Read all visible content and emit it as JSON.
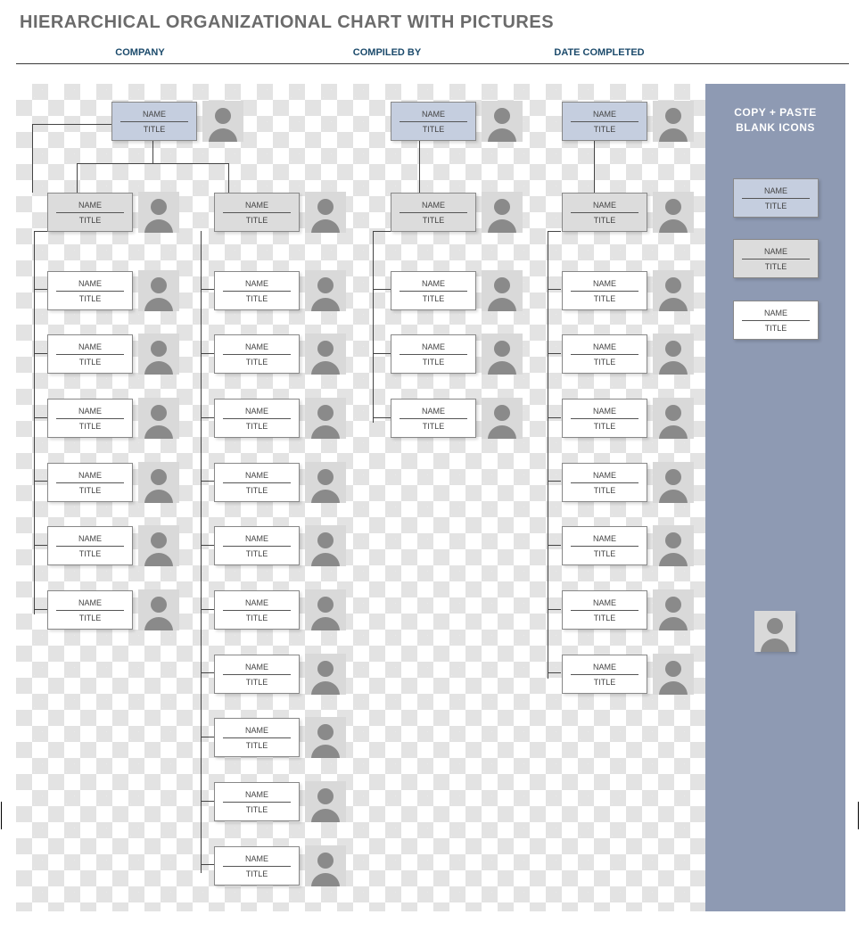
{
  "title": "HIERARCHICAL ORGANIZATIONAL CHART WITH PICTURES",
  "header": {
    "company": "COMPANY",
    "compiled_by": "COMPILED BY",
    "date_completed": "DATE COMPLETED"
  },
  "sidebar": {
    "title": "COPY + PASTE BLANK ICONS",
    "sample_top": {
      "name": "NAME",
      "title": "TITLE"
    },
    "sample_mid": {
      "name": "NAME",
      "title": "TITLE"
    },
    "sample_white": {
      "name": "NAME",
      "title": "TITLE"
    }
  },
  "people": {
    "col1_top": {
      "name": "NAME",
      "title": "TITLE"
    },
    "col1_m1": {
      "name": "NAME",
      "title": "TITLE"
    },
    "col1_m2": {
      "name": "NAME",
      "title": "TITLE"
    },
    "col1_1": {
      "name": "NAME",
      "title": "TITLE"
    },
    "col1_2": {
      "name": "NAME",
      "title": "TITLE"
    },
    "col1_3": {
      "name": "NAME",
      "title": "TITLE"
    },
    "col1_4": {
      "name": "NAME",
      "title": "TITLE"
    },
    "col1_5": {
      "name": "NAME",
      "title": "TITLE"
    },
    "col1_6": {
      "name": "NAME",
      "title": "TITLE"
    },
    "col2_1": {
      "name": "NAME",
      "title": "TITLE"
    },
    "col2_2": {
      "name": "NAME",
      "title": "TITLE"
    },
    "col2_3": {
      "name": "NAME",
      "title": "TITLE"
    },
    "col2_4": {
      "name": "NAME",
      "title": "TITLE"
    },
    "col2_5": {
      "name": "NAME",
      "title": "TITLE"
    },
    "col2_6": {
      "name": "NAME",
      "title": "TITLE"
    },
    "col2_7": {
      "name": "NAME",
      "title": "TITLE"
    },
    "col2_8": {
      "name": "NAME",
      "title": "TITLE"
    },
    "col2_9": {
      "name": "NAME",
      "title": "TITLE"
    },
    "col2_10": {
      "name": "NAME",
      "title": "TITLE"
    },
    "col3_top": {
      "name": "NAME",
      "title": "TITLE"
    },
    "col3_mid": {
      "name": "NAME",
      "title": "TITLE"
    },
    "col3_1": {
      "name": "NAME",
      "title": "TITLE"
    },
    "col3_2": {
      "name": "NAME",
      "title": "TITLE"
    },
    "col3_3": {
      "name": "NAME",
      "title": "TITLE"
    },
    "col4_top": {
      "name": "NAME",
      "title": "TITLE"
    },
    "col4_mid": {
      "name": "NAME",
      "title": "TITLE"
    },
    "col4_1": {
      "name": "NAME",
      "title": "TITLE"
    },
    "col4_2": {
      "name": "NAME",
      "title": "TITLE"
    },
    "col4_3": {
      "name": "NAME",
      "title": "TITLE"
    },
    "col4_4": {
      "name": "NAME",
      "title": "TITLE"
    },
    "col4_5": {
      "name": "NAME",
      "title": "TITLE"
    },
    "col4_6": {
      "name": "NAME",
      "title": "TITLE"
    },
    "col4_7": {
      "name": "NAME",
      "title": "TITLE"
    }
  }
}
